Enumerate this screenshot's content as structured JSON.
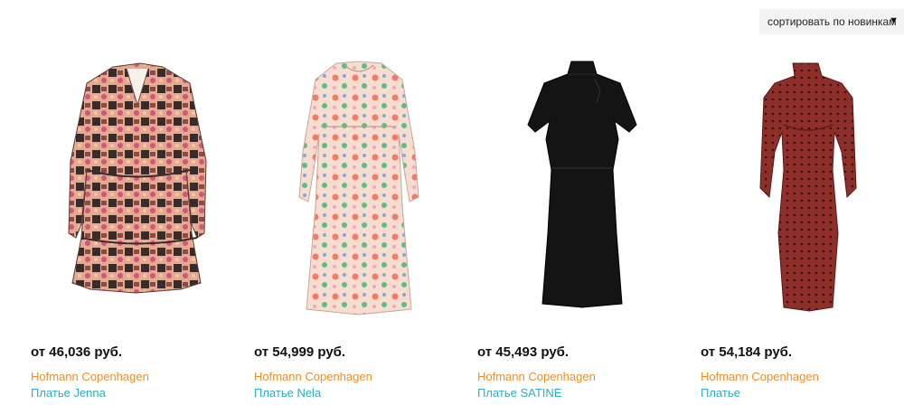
{
  "sort": {
    "label": "сортировать по новинкам",
    "arrow": "▼"
  },
  "products": [
    {
      "price": "от 46,036 руб.",
      "brand": "Hofmann Copenhagen",
      "name": "Платье Jenna",
      "image": "patterned-boho-dress"
    },
    {
      "price": "от 54,999 руб.",
      "brand": "Hofmann Copenhagen",
      "name": "Платье Nela",
      "image": "floral-maxi-dress"
    },
    {
      "price": "от 45,493 руб.",
      "brand": "Hofmann Copenhagen",
      "name": "Платье SATINE",
      "image": "black-midi-dress"
    },
    {
      "price": "от 54,184 руб.",
      "brand": "Hofmann Copenhagen",
      "name": "Платье",
      "image": "burgundy-dotted-dress"
    }
  ],
  "colors": {
    "brand": "#e8902a",
    "product_name": "#2ab0bf",
    "sort_bg": "#f3f3f3"
  }
}
